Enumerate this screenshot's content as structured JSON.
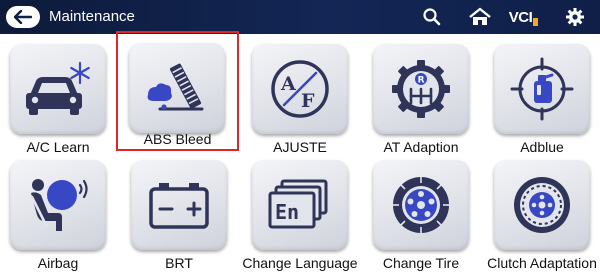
{
  "header": {
    "title": "Maintenance",
    "vcl_label": "VCI"
  },
  "tiles": [
    {
      "label": "A/C Learn",
      "icon": "car-snowflake-icon"
    },
    {
      "label": "ABS Bleed",
      "icon": "abs-bleed-icon",
      "selected": true
    },
    {
      "label": "AJUSTE",
      "icon": "af-gauge-icon"
    },
    {
      "label": "AT Adaption",
      "icon": "gear-shift-icon"
    },
    {
      "label": "Adblue",
      "icon": "adblue-bottle-icon"
    },
    {
      "label": "Airbag",
      "icon": "airbag-icon"
    },
    {
      "label": "BRT",
      "icon": "battery-icon"
    },
    {
      "label": "Change Language",
      "icon": "language-en-icon"
    },
    {
      "label": "Change Tire",
      "icon": "tire-icon"
    },
    {
      "label": "Clutch Adaptation",
      "icon": "clutch-icon"
    }
  ],
  "colors": {
    "topbar": "#132655",
    "icon_navy": "#2f3458",
    "icon_blue": "#3848c4",
    "selection": "#e0262a"
  }
}
